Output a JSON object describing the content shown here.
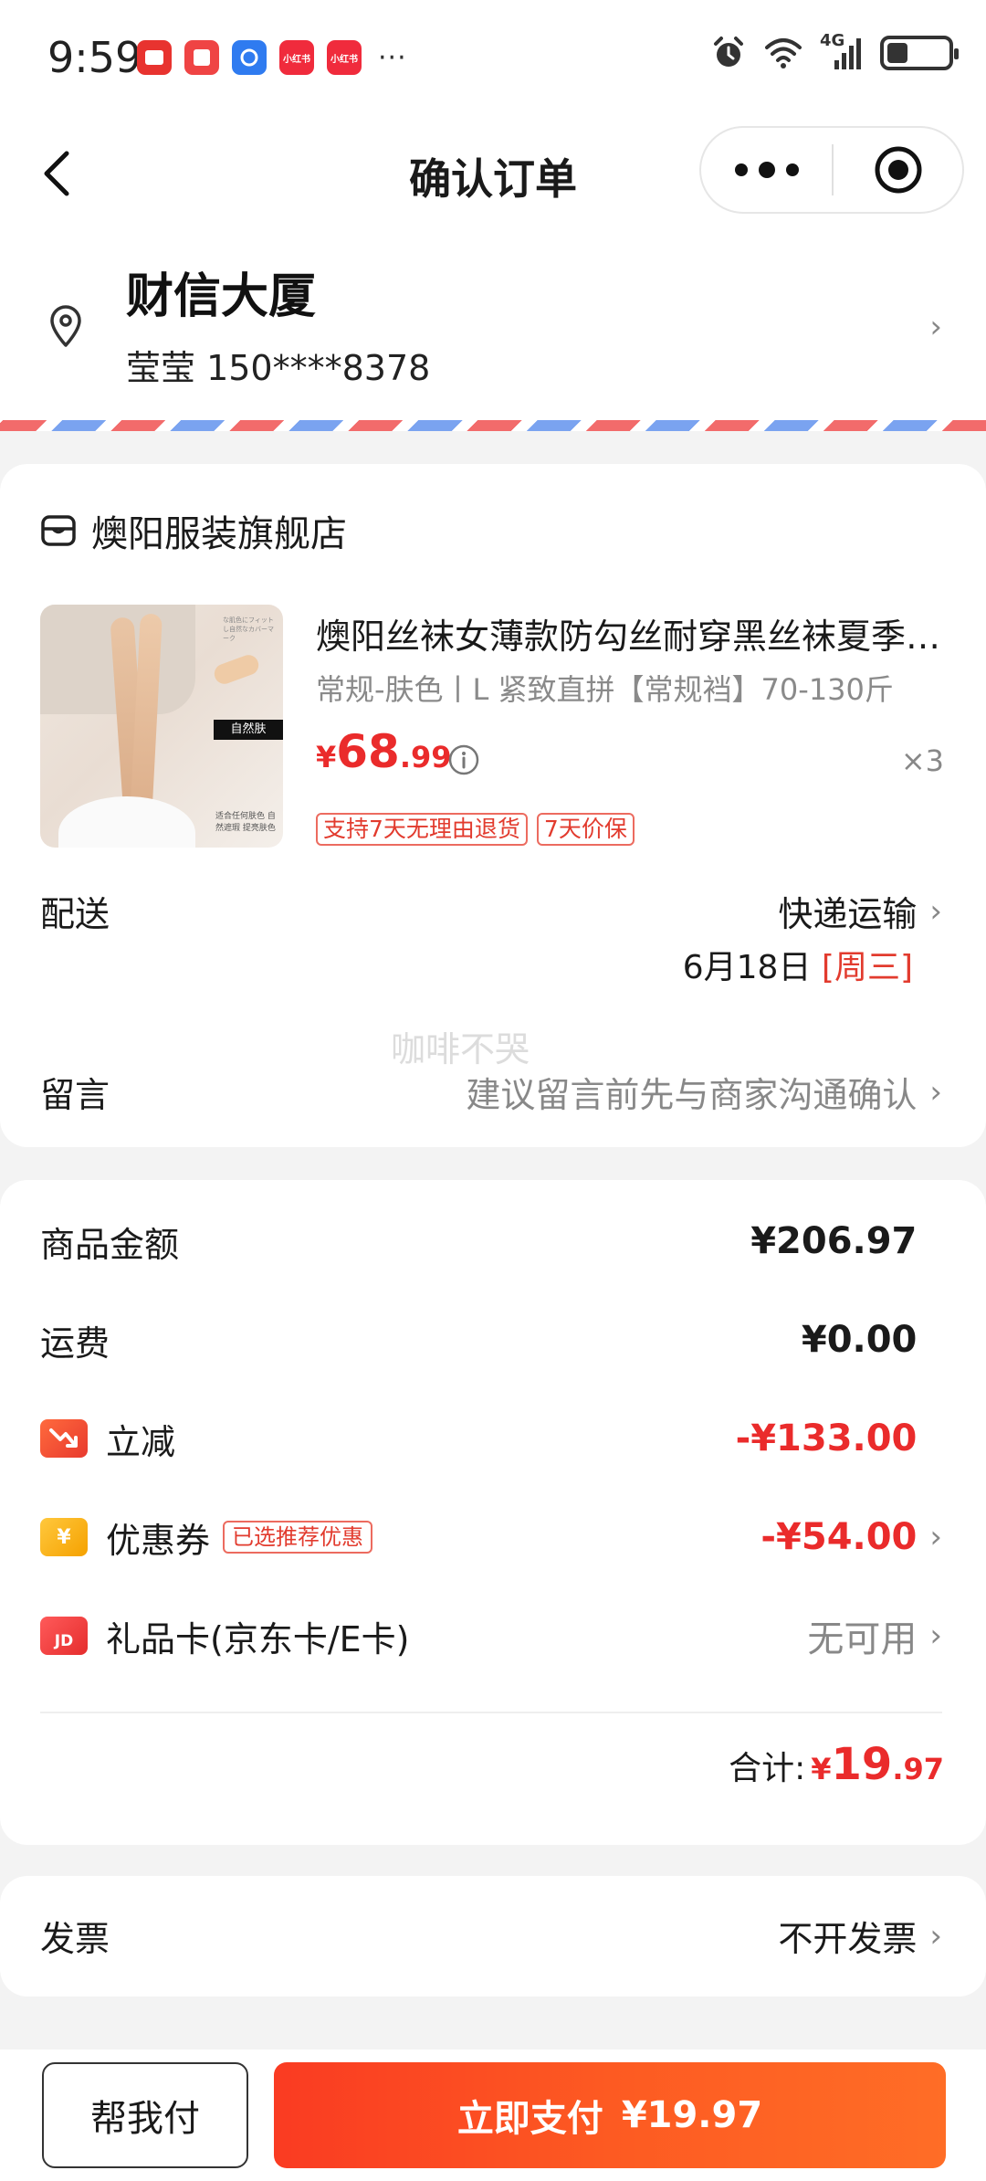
{
  "status_bar": {
    "time": "9:59",
    "more": "···",
    "network": "4G",
    "battery_level_percent": 35,
    "app_icons": [
      {
        "name": "app-icon-1",
        "color": "#e8332f",
        "text": ""
      },
      {
        "name": "app-icon-2",
        "color": "#ef4444",
        "text": ""
      },
      {
        "name": "app-icon-3",
        "color": "#2f7bf0",
        "text": ""
      },
      {
        "name": "xiaohongshu-icon",
        "color": "#f02b3c",
        "text": "小红书"
      },
      {
        "name": "xiaohongshu-icon",
        "color": "#f02b3c",
        "text": "小红书"
      }
    ]
  },
  "nav": {
    "title": "确认订单"
  },
  "address": {
    "title": "财信大厦",
    "contact": "莹莹  150****8378"
  },
  "shop": {
    "name": "燠阳服装旗舰店"
  },
  "product": {
    "title": "燠阳丝袜女薄款防勾丝耐穿黑丝袜夏季超薄",
    "spec": "常规-肤色丨L 紧致直拼【常规裆】70-130斤",
    "price_symbol": "¥",
    "price_int": "68",
    "price_dec": ".99",
    "quantity": "×3",
    "badges": [
      "支持7天无理由退货",
      "7天价保"
    ],
    "image_tag": "自然肤",
    "image_small_text": "适合任何肤色 自然遮瑕 提亮肤色",
    "image_tiny_text": "な肌色にフィットし自然なカバーマーク"
  },
  "delivery": {
    "label": "配送",
    "method": "快递运输",
    "date": "6月18日",
    "weekday": "[周三]"
  },
  "watermark": "咖啡不哭",
  "message": {
    "label": "留言",
    "placeholder": "建议留言前先与商家沟通确认"
  },
  "amounts": {
    "goods_label": "商品金额",
    "goods_value": "¥206.97",
    "shipping_label": "运费",
    "shipping_value": "¥0.00",
    "discount_label": "立减",
    "discount_value": "-¥133.00",
    "coupon_label": "优惠券",
    "coupon_tag": "已选推荐优惠",
    "coupon_icon_text": "¥",
    "coupon_value": "-¥54.00",
    "giftcard_label": "礼品卡(京东卡/E卡)",
    "giftcard_icon_text": "JD",
    "giftcard_value": "无可用",
    "total_label": "合计:",
    "total_symbol": "¥",
    "total_int": "19",
    "total_dec": ".97"
  },
  "invoice": {
    "label": "发票",
    "value": "不开发票"
  },
  "bottom": {
    "help_label": "帮我付",
    "pay_label": "立即支付",
    "pay_amount": "¥19.97"
  },
  "colors": {
    "accent_red": "#ea2b2b",
    "pay_gradient_start": "#fa3b22",
    "pay_gradient_end": "#ff6d26"
  }
}
